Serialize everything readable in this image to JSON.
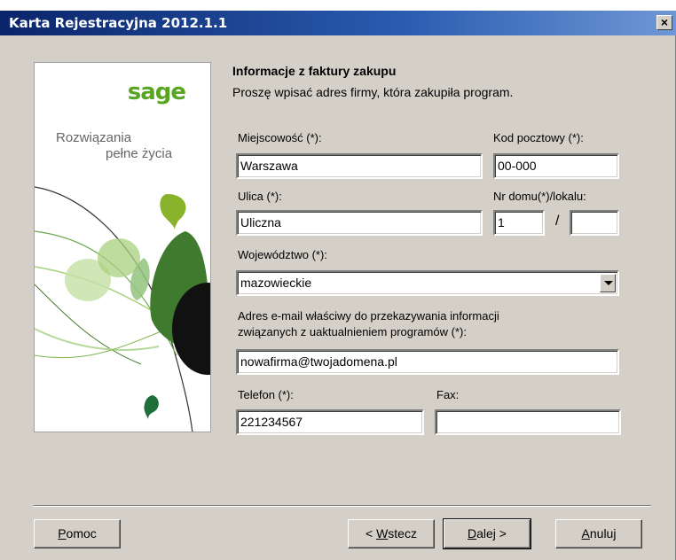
{
  "window": {
    "title": "Karta Rejestracyjna 2012.1.1",
    "close": "×"
  },
  "side": {
    "logo": "sage",
    "slogan_line1": "Rozwiązania",
    "slogan_line2": "pełne życia"
  },
  "form": {
    "heading": "Informacje z faktury zakupu",
    "subheading": "Proszę wpisać adres firmy, która zakupiła program.",
    "city_label": "Miejscowość (*):",
    "city_value": "Warszawa",
    "postal_label": "Kod pocztowy (*):",
    "postal_value": "00-000",
    "street_label": "Ulica (*):",
    "street_value": "Uliczna",
    "house_label": "Nr domu(*)/lokalu:",
    "house_value": "1",
    "flat_value": "",
    "slash": "/",
    "province_label": "Województwo (*):",
    "province_value": "mazowieckie",
    "email_label_line1": "Adres e-mail właściwy do przekazywania informacji",
    "email_label_line2": "związanych z uaktualnieniem programów (*):",
    "email_value": "nowafirma@twojadomena.pl",
    "phone_label": "Telefon (*):",
    "phone_value": "221234567",
    "fax_label": "Fax:",
    "fax_value": ""
  },
  "buttons": {
    "help": {
      "key": "P",
      "rest": "omoc"
    },
    "back": {
      "pre": "< ",
      "key": "W",
      "rest": "stecz"
    },
    "next": {
      "key": "D",
      "rest": "alej >"
    },
    "cancel": {
      "key": "A",
      "rest": "nuluj"
    }
  }
}
